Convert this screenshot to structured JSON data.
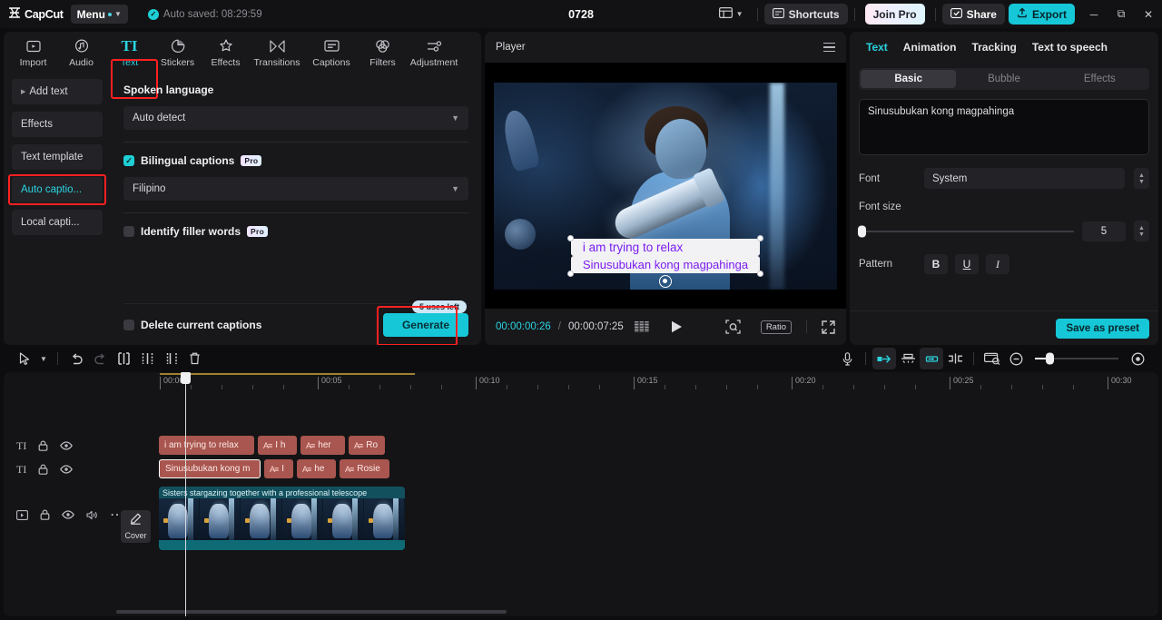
{
  "titlebar": {
    "brand": "CapCut",
    "menu_label": "Menu",
    "autosave": "Auto saved: 08:29:59",
    "project_title": "0728",
    "layout_icon": "layout-icon",
    "shortcuts_label": "Shortcuts",
    "join_pro_label": "Join Pro",
    "share_label": "Share",
    "export_label": "Export",
    "minimize": "─",
    "maximize": "❐",
    "close": "✕"
  },
  "tooltabs": [
    {
      "label": "Import",
      "icon": "import-icon"
    },
    {
      "label": "Audio",
      "icon": "audio-icon"
    },
    {
      "label": "Text",
      "icon": "text-icon"
    },
    {
      "label": "Stickers",
      "icon": "stickers-icon"
    },
    {
      "label": "Effects",
      "icon": "effects-icon"
    },
    {
      "label": "Transitions",
      "icon": "transitions-icon"
    },
    {
      "label": "Captions",
      "icon": "captions-icon"
    },
    {
      "label": "Filters",
      "icon": "filters-icon"
    },
    {
      "label": "Adjustment",
      "icon": "adjustment-icon"
    }
  ],
  "sidelist": [
    {
      "label": "Add text"
    },
    {
      "label": "Effects"
    },
    {
      "label": "Text template"
    },
    {
      "label": "Auto captio..."
    },
    {
      "label": "Local capti..."
    }
  ],
  "captions_panel": {
    "spoken_language_title": "Spoken language",
    "spoken_language_value": "Auto detect",
    "bilingual_label": "Bilingual captions",
    "bilingual_badge": "Pro",
    "bilingual_checked": true,
    "bilingual_language_value": "Filipino",
    "filler_label": "Identify filler words",
    "filler_badge": "Pro",
    "delete_label": "Delete current captions",
    "uses_left": "5 uses left",
    "generate_label": "Generate"
  },
  "player": {
    "title": "Player",
    "caption_line1": "i am trying to relax",
    "caption_line2": "Sinusubukan kong magpahinga",
    "current_time": "00:00:00:26",
    "separator": "/",
    "total_time": "00:00:07:25",
    "ratio_label": "Ratio"
  },
  "right_panel": {
    "tabs": [
      "Text",
      "Animation",
      "Tracking",
      "Text to speech"
    ],
    "segments": [
      "Basic",
      "Bubble",
      "Effects"
    ],
    "text_value": "Sinusubukan kong magpahinga",
    "font_label": "Font",
    "font_value": "System",
    "font_size_label": "Font size",
    "font_size_value": "5",
    "pattern_label": "Pattern",
    "bold": "B",
    "underline": "U",
    "italic": "I",
    "save_preset_label": "Save as preset"
  },
  "timeline": {
    "ruler_labels": [
      "00:00",
      "00:05",
      "00:10",
      "00:15",
      "00:20",
      "00:25",
      "00:30"
    ],
    "cover_label": "Cover",
    "text_track_1": [
      {
        "label": "i am trying to relax",
        "has_icon": false
      },
      {
        "label": "I h",
        "has_icon": true
      },
      {
        "label": "her",
        "has_icon": true
      },
      {
        "label": "Ro",
        "has_icon": true
      }
    ],
    "text_track_2": [
      {
        "label": "Sinusubukan kong m",
        "has_icon": false,
        "selected": true
      },
      {
        "label": "I",
        "has_icon": true
      },
      {
        "label": "he",
        "has_icon": true
      },
      {
        "label": "Rosie",
        "has_icon": true
      }
    ],
    "video_clip_title": "Sisters stargazing together with a professional telescope"
  }
}
